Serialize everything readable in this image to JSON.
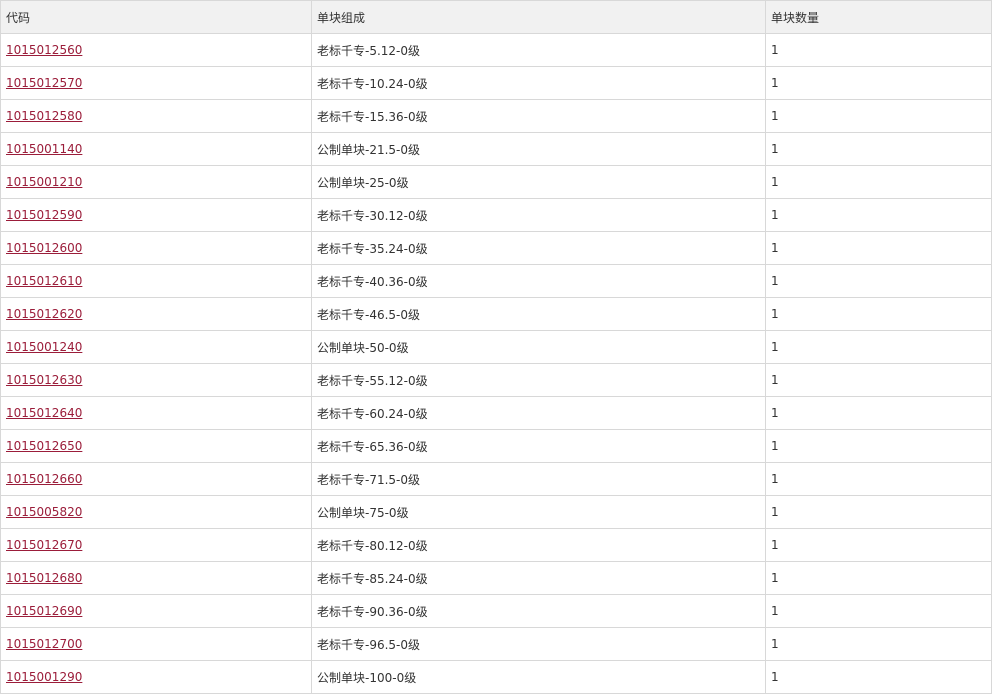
{
  "table": {
    "headers": [
      "代码",
      "单块组成",
      "单块数量"
    ],
    "rows": [
      {
        "code": "1015012560",
        "composition": "老标千专-5.12-0级",
        "quantity": "1"
      },
      {
        "code": "1015012570",
        "composition": "老标千专-10.24-0级",
        "quantity": "1"
      },
      {
        "code": "1015012580",
        "composition": "老标千专-15.36-0级",
        "quantity": "1"
      },
      {
        "code": "1015001140",
        "composition": "公制单块-21.5-0级",
        "quantity": "1"
      },
      {
        "code": "1015001210",
        "composition": "公制单块-25-0级",
        "quantity": "1"
      },
      {
        "code": "1015012590",
        "composition": "老标千专-30.12-0级",
        "quantity": "1"
      },
      {
        "code": "1015012600",
        "composition": "老标千专-35.24-0级",
        "quantity": "1"
      },
      {
        "code": "1015012610",
        "composition": "老标千专-40.36-0级",
        "quantity": "1"
      },
      {
        "code": "1015012620",
        "composition": "老标千专-46.5-0级",
        "quantity": "1"
      },
      {
        "code": "1015001240",
        "composition": "公制单块-50-0级",
        "quantity": "1"
      },
      {
        "code": "1015012630",
        "composition": "老标千专-55.12-0级",
        "quantity": "1"
      },
      {
        "code": "1015012640",
        "composition": "老标千专-60.24-0级",
        "quantity": "1"
      },
      {
        "code": "1015012650",
        "composition": "老标千专-65.36-0级",
        "quantity": "1"
      },
      {
        "code": "1015012660",
        "composition": "老标千专-71.5-0级",
        "quantity": "1"
      },
      {
        "code": "1015005820",
        "composition": "公制单块-75-0级",
        "quantity": "1"
      },
      {
        "code": "1015012670",
        "composition": "老标千专-80.12-0级",
        "quantity": "1"
      },
      {
        "code": "1015012680",
        "composition": "老标千专-85.24-0级",
        "quantity": "1"
      },
      {
        "code": "1015012690",
        "composition": "老标千专-90.36-0级",
        "quantity": "1"
      },
      {
        "code": "1015012700",
        "composition": "老标千专-96.5-0级",
        "quantity": "1"
      },
      {
        "code": "1015001290",
        "composition": "公制单块-100-0级",
        "quantity": "1"
      }
    ]
  },
  "colors": {
    "link": "#9b1d3a",
    "header_bg": "#f1f1f1",
    "border": "#d8d8d8",
    "text": "#333333"
  }
}
